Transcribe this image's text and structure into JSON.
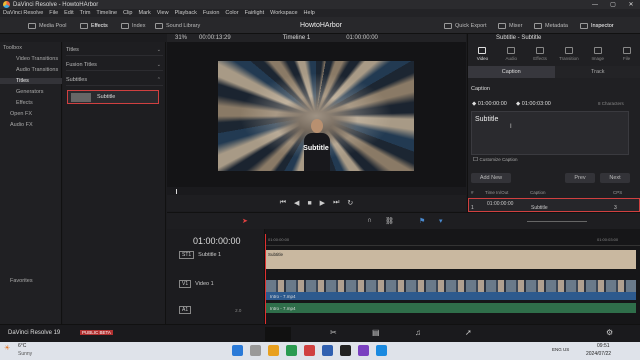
{
  "window": {
    "title": "DaVinci Resolve - HowtoHArbor",
    "controls": [
      "—",
      "▢",
      "✕"
    ]
  },
  "menu": [
    "DaVinci Resolve",
    "File",
    "Edit",
    "Trim",
    "Timeline",
    "Clip",
    "Mark",
    "View",
    "Playback",
    "Fusion",
    "Color",
    "Fairlight",
    "Workspace",
    "Help"
  ],
  "toolbar": {
    "media_pool": "Media Pool",
    "effects": "Effects",
    "index": "Index",
    "sound_library": "Sound Library",
    "project": "HowtoHArbor",
    "quick_export": "Quick Export",
    "mixer": "Mixer",
    "metadata": "Metadata",
    "inspector": "Inspector"
  },
  "left_panel": {
    "items": [
      "Toolbox",
      "Video Transitions",
      "Audio Transitions",
      "Titles",
      "Generators",
      "Effects",
      "Open FX",
      "Audio FX"
    ],
    "favorites": "Favorites"
  },
  "mid_panel": {
    "sections": [
      "Titles",
      "Fusion Titles",
      "Subtitles"
    ],
    "selected_item": "Subtitle"
  },
  "viewer": {
    "zoom": "31%",
    "timecode_left": "00:00:13:29",
    "timeline_name": "Timeline 1",
    "timecode_right": "01:00:00:00",
    "subtitle_overlay": "Subtitle"
  },
  "inspector": {
    "title": "Subtitle - Subtitle",
    "tabs": [
      "Video",
      "Audio",
      "Effects",
      "Transition",
      "Image",
      "File"
    ],
    "subtabs": [
      "Caption",
      "Track"
    ],
    "caption_label": "Caption",
    "tc_in": "01:00:00:00",
    "tc_out": "01:00:03:00",
    "chars": "8 Characters",
    "caption_text": "Subtitle",
    "customize": "Customize Caption",
    "add_new": "Add New",
    "prev": "Prev",
    "next": "Next",
    "list_headers": [
      "#",
      "Time In/Out",
      "Caption",
      "CPS"
    ],
    "row": {
      "num": "1",
      "time_in": "01:00:00:00",
      "caption": "Subtitle",
      "cps": "3"
    }
  },
  "timeline": {
    "timecode": "01:00:00:00",
    "ruler": [
      "01:00:00:00",
      "01:00:03:00"
    ],
    "tracks": [
      {
        "tag": "ST1",
        "name": "Subtitle 1"
      },
      {
        "tag": "V1",
        "name": "Video 1"
      },
      {
        "tag": "A1",
        "name": "",
        "level": "2.0"
      }
    ],
    "subtitle_clip": "Subtitle",
    "video_clip": "Intro - 7.mp4",
    "audio_clip": "Intro - 7.mp4"
  },
  "footer": {
    "app": "DaVinci Resolve 19",
    "badge": "PUBLIC BETA"
  },
  "taskbar": {
    "temp": "6°C",
    "weather": "Sunny",
    "search": "Search",
    "lang1": "ENG",
    "lang2": "US",
    "time": "09:51",
    "date": "2024/07/22"
  },
  "colors": {
    "accent": "#d04040",
    "video_track": "#2d5a8e",
    "audio_track": "#2f6e4a",
    "subtitle_clip": "#c9b8a0"
  }
}
